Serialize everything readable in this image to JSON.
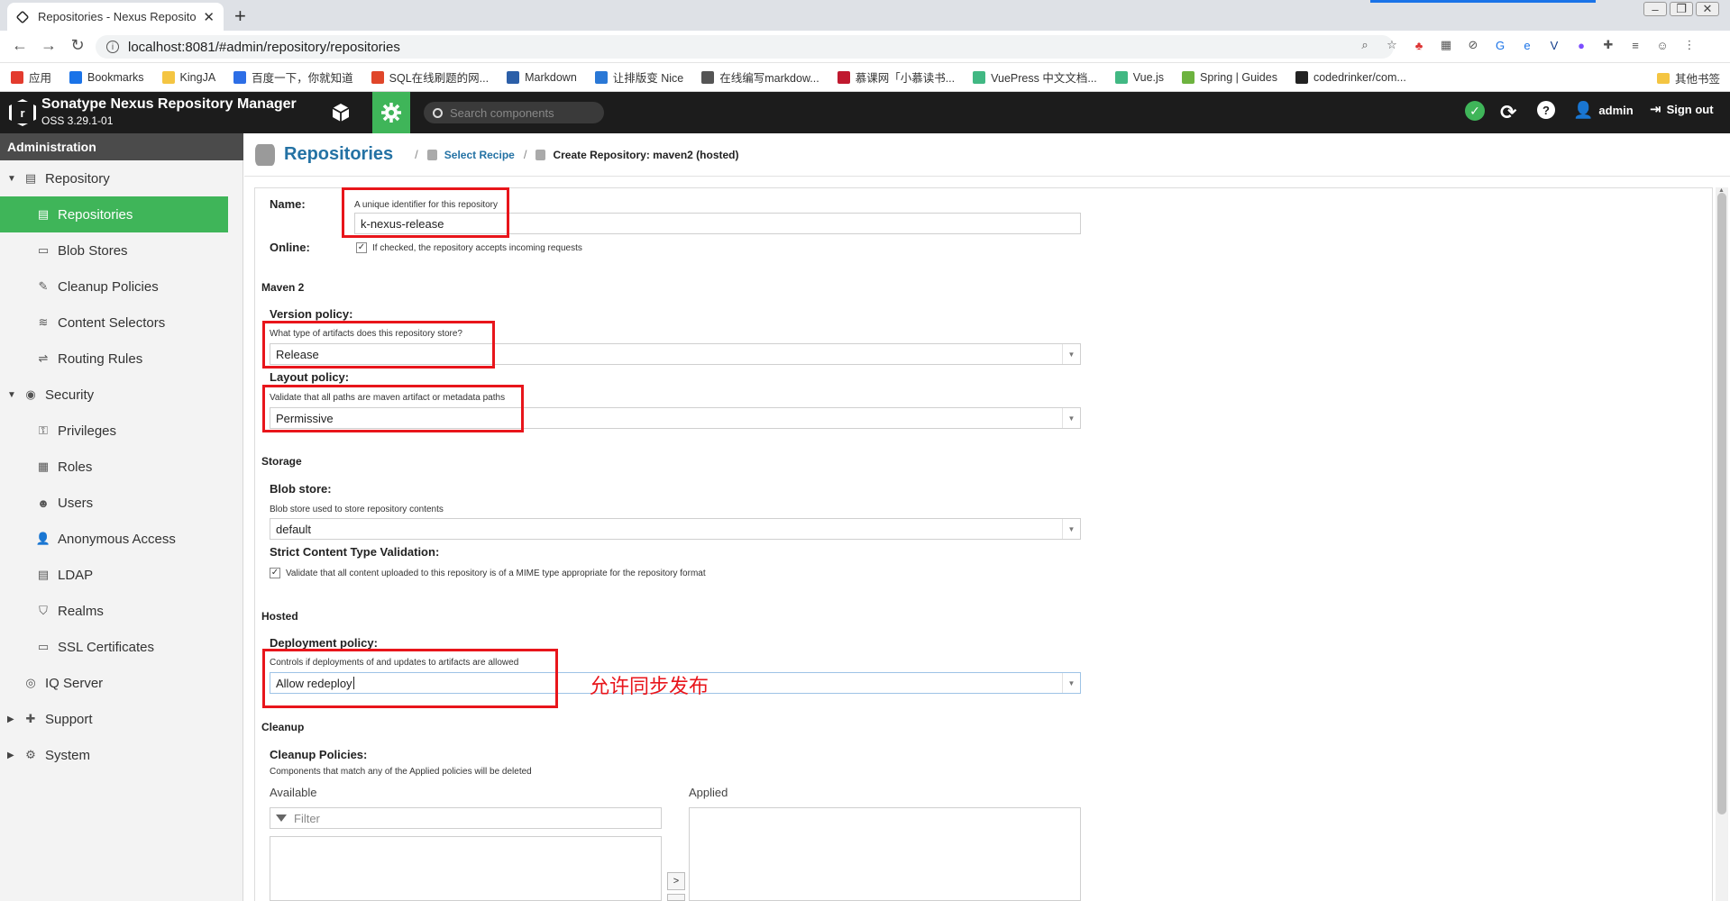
{
  "browser": {
    "tab_title": "Repositories - Nexus Reposito",
    "url": "localhost:8081/#admin/repository/repositories",
    "bookmarks": [
      {
        "label": "应用",
        "color": "#e33b2e"
      },
      {
        "label": "Bookmarks",
        "color": "#1a73e8"
      },
      {
        "label": "KingJA",
        "color": "#f4c542"
      },
      {
        "label": "百度一下，你就知道",
        "color": "#2d6ee6"
      },
      {
        "label": "SQL在线刷题的网...",
        "color": "#e0462a"
      },
      {
        "label": "Markdown",
        "color": "#2c5fa8"
      },
      {
        "label": "让排版变 Nice",
        "color": "#2a78d6"
      },
      {
        "label": "在线编写markdow...",
        "color": "#555555"
      },
      {
        "label": "慕课网「小慕读书...",
        "color": "#c0192f"
      },
      {
        "label": "VuePress 中文文档...",
        "color": "#41b883"
      },
      {
        "label": "Vue.js",
        "color": "#41b883"
      },
      {
        "label": "Spring | Guides",
        "color": "#6db33f"
      },
      {
        "label": "codedrinker/com...",
        "color": "#222222"
      }
    ],
    "other_bookmarks": "其他书签"
  },
  "header": {
    "title": "Sonatype Nexus Repository Manager",
    "version": "OSS 3.29.1-01",
    "search_placeholder": "Search components",
    "user": "admin",
    "signout": "Sign out"
  },
  "sidebar": {
    "heading": "Administration",
    "items": [
      {
        "label": "Repository",
        "level": 0,
        "expanded": true
      },
      {
        "label": "Repositories",
        "level": 1,
        "active": true
      },
      {
        "label": "Blob Stores",
        "level": 1
      },
      {
        "label": "Cleanup Policies",
        "level": 1
      },
      {
        "label": "Content Selectors",
        "level": 1
      },
      {
        "label": "Routing Rules",
        "level": 1
      },
      {
        "label": "Security",
        "level": 0,
        "expanded": true
      },
      {
        "label": "Privileges",
        "level": 1
      },
      {
        "label": "Roles",
        "level": 1
      },
      {
        "label": "Users",
        "level": 1
      },
      {
        "label": "Anonymous Access",
        "level": 1
      },
      {
        "label": "LDAP",
        "level": 1
      },
      {
        "label": "Realms",
        "level": 1
      },
      {
        "label": "SSL Certificates",
        "level": 1
      },
      {
        "label": "IQ Server",
        "level": 0
      },
      {
        "label": "Support",
        "level": 0,
        "expanded": false
      },
      {
        "label": "System",
        "level": 0,
        "expanded": false
      }
    ]
  },
  "breadcrumb": {
    "title": "Repositories",
    "step1": "Select Recipe",
    "step2": "Create Repository: maven2 (hosted)"
  },
  "form": {
    "name_label": "Name:",
    "name_help": "A unique identifier for this repository",
    "name_value": "k-nexus-release",
    "online_label": "Online:",
    "online_help": "If checked, the repository accepts incoming requests",
    "online_checked": true,
    "maven_section": "Maven 2",
    "version_label": "Version policy:",
    "version_help": "What type of artifacts does this repository store?",
    "version_value": "Release",
    "layout_label": "Layout policy:",
    "layout_help": "Validate that all paths are maven artifact or metadata paths",
    "layout_value": "Permissive",
    "storage_section": "Storage",
    "blob_label": "Blob store:",
    "blob_help": "Blob store used to store repository contents",
    "blob_value": "default",
    "strict_label": "Strict Content Type Validation:",
    "strict_help": "Validate that all content uploaded to this repository is of a MIME type appropriate for the repository format",
    "strict_checked": true,
    "hosted_section": "Hosted",
    "deploy_label": "Deployment policy:",
    "deploy_help": "Controls if deployments of and updates to artifacts are allowed",
    "deploy_value": "Allow redeploy",
    "cleanup_section": "Cleanup",
    "cleanup_label": "Cleanup Policies:",
    "cleanup_help": "Components that match any of the Applied policies will be deleted",
    "available_label": "Available",
    "applied_label": "Applied",
    "filter_placeholder": "Filter",
    "move_right": ">"
  },
  "annotation": {
    "text": "允许同步发布",
    "color": "#e8151b"
  },
  "colors": {
    "accent_green": "#3fb559",
    "header_bg": "#1c1c1c",
    "link_blue": "#2472a4"
  }
}
